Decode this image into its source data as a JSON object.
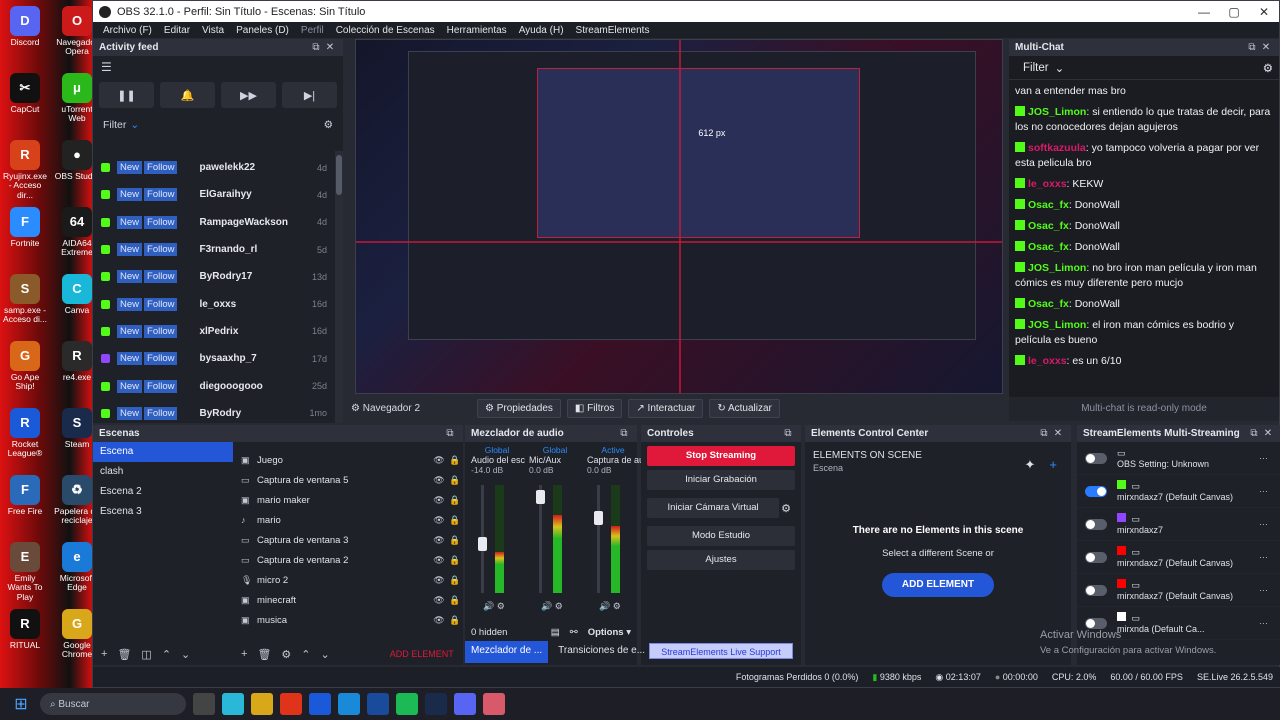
{
  "window": {
    "title": "OBS 32.1.0 - Perfil: Sin Título - Escenas: Sin Título"
  },
  "menu": [
    "Archivo (F)",
    "Editar",
    "Vista",
    "Paneles (D)",
    "Perfil",
    "Colección de Escenas",
    "Herramientas",
    "Ayuda (H)",
    "StreamElements"
  ],
  "desktop_icons": [
    {
      "label": "Discord",
      "color": "#5865f2",
      "glyph": "D"
    },
    {
      "label": "CapCut",
      "color": "#111111",
      "glyph": "✂"
    },
    {
      "label": "Ryujinx.exe - Acceso dir...",
      "color": "#d8421a",
      "glyph": "R"
    },
    {
      "label": "Fortnite",
      "color": "#2a8cff",
      "glyph": "F"
    },
    {
      "label": "samp.exe - Acceso di...",
      "color": "#8a5a2a",
      "glyph": "S"
    },
    {
      "label": "Go Ape Ship!",
      "color": "#d8671a",
      "glyph": "G"
    },
    {
      "label": "Rocket League®",
      "color": "#1a5ad8",
      "glyph": "R"
    },
    {
      "label": "Free Fire",
      "color": "#2a6ab8",
      "glyph": "F"
    },
    {
      "label": "Emily Wants To Play",
      "color": "#6a4a3a",
      "glyph": "E"
    },
    {
      "label": "RITUAL",
      "color": "#111111",
      "glyph": "R"
    }
  ],
  "desktop_icons2": [
    {
      "label": "Navegador Opera",
      "color": "#cc1a1a",
      "glyph": "O"
    },
    {
      "label": "uTorrent Web",
      "color": "#2ab81a",
      "glyph": "μ"
    },
    {
      "label": "OBS Studio",
      "color": "#222222",
      "glyph": "●"
    },
    {
      "label": "AIDA64 Extreme",
      "color": "#1a1a1a",
      "glyph": "64"
    },
    {
      "label": "Canva",
      "color": "#1ab8d8",
      "glyph": "C"
    },
    {
      "label": "re4.exe",
      "color": "#2a2a2a",
      "glyph": "R"
    },
    {
      "label": "Steam",
      "color": "#1a2a4a",
      "glyph": "S"
    },
    {
      "label": "Papelera de reciclaje",
      "color": "#2a4a6a",
      "glyph": "♻"
    },
    {
      "label": "Microsoft Edge",
      "color": "#1a7ad8",
      "glyph": "e"
    },
    {
      "label": "Google Chrome",
      "color": "#d8a81a",
      "glyph": "G"
    }
  ],
  "activity": {
    "title": "Activity feed",
    "filter": "Filter",
    "new_label": "New",
    "follow_label": "Follow",
    "items": [
      {
        "name": "pawelekk22",
        "ago": "4d",
        "platform": "kick"
      },
      {
        "name": "ElGaraihyy",
        "ago": "4d",
        "platform": "kick"
      },
      {
        "name": "RampageWackson",
        "ago": "4d",
        "platform": "kick"
      },
      {
        "name": "F3rnando_rl",
        "ago": "5d",
        "platform": "kick"
      },
      {
        "name": "ByRodry17",
        "ago": "13d",
        "platform": "kick"
      },
      {
        "name": "le_oxxs",
        "ago": "16d",
        "platform": "kick"
      },
      {
        "name": "xlPedrix",
        "ago": "16d",
        "platform": "kick"
      },
      {
        "name": "bysaaxhp_7",
        "ago": "17d",
        "platform": "twitch"
      },
      {
        "name": "diegooogooo",
        "ago": "25d",
        "platform": "kick"
      },
      {
        "name": "ByRodry",
        "ago": "1mo",
        "platform": "kick"
      }
    ]
  },
  "preview": {
    "zoom_label": "612 px"
  },
  "source_toolbar": {
    "nav": "Navegador 2",
    "props": "Propiedades",
    "filters": "Filtros",
    "interact": "Interactuar",
    "refresh": "Actualizar"
  },
  "multichat": {
    "title": "Multi-Chat",
    "filter": "Filter",
    "footer": "Multi-chat is read-only mode",
    "messages": [
      {
        "user": "",
        "text": "van a entender mas bro",
        "color": "#ffffff"
      },
      {
        "user": "JOS_Limon",
        "text": "si entiendo lo que tratas de decir, para los no conocedores dejan agujeros",
        "color": "#53fc18"
      },
      {
        "user": "softkazuula",
        "text": "yo tampoco volveria a pagar por ver esta pelicula bro",
        "color": "#d81a6a"
      },
      {
        "user": "le_oxxs",
        "text": "KEKW",
        "color": "#d81a6a"
      },
      {
        "user": "Osac_fx",
        "text": "DonoWall",
        "color": "#53fc18"
      },
      {
        "user": "Osac_fx",
        "text": "DonoWall",
        "color": "#53fc18"
      },
      {
        "user": "Osac_fx",
        "text": "DonoWall",
        "color": "#53fc18"
      },
      {
        "user": "JOS_Limon",
        "text": "no bro iron man película y iron man cómics es muy diferente pero mucjo",
        "color": "#53fc18"
      },
      {
        "user": "Osac_fx",
        "text": "DonoWall",
        "color": "#53fc18"
      },
      {
        "user": "JOS_Limon",
        "text": "el iron man cómics es bodrio y película es bueno",
        "color": "#53fc18"
      },
      {
        "user": "le_oxxs",
        "text": "es un 6/10",
        "color": "#d81a6a"
      }
    ]
  },
  "scenes": {
    "title": "Escenas",
    "items": [
      "Escena",
      "clash",
      "Escena 2",
      "Escena 3"
    ],
    "selected": 0
  },
  "sources": {
    "items": [
      {
        "name": "Juego",
        "icon": "▣"
      },
      {
        "name": "Captura de ventana 5",
        "icon": "▭"
      },
      {
        "name": "mario maker",
        "icon": "▣"
      },
      {
        "name": "mario",
        "icon": "♪"
      },
      {
        "name": "Captura de ventana 3",
        "icon": "▭"
      },
      {
        "name": "Captura de ventana 2",
        "icon": "▭"
      },
      {
        "name": "micro 2",
        "icon": "🎙"
      },
      {
        "name": "minecraft",
        "icon": "▣"
      },
      {
        "name": "musica",
        "icon": "▣"
      }
    ],
    "add_element": "ADD ELEMENT"
  },
  "mixer": {
    "title": "Mezclador de audio",
    "channels": [
      {
        "group": "Global",
        "name": "Audio del escritorio",
        "db": "-14.0 dB",
        "level": 0.38,
        "fader": 0.55
      },
      {
        "group": "Global",
        "name": "Mic/Aux",
        "db": "0.0 dB",
        "level": 0.72,
        "fader": 0.05
      },
      {
        "group": "Active",
        "name": "Captura de audio",
        "db": "0.0 dB",
        "level": 0.62,
        "fader": 0.28
      }
    ],
    "hidden": "0 hidden",
    "options": "Options",
    "tab_active": "Mezclador de ...",
    "tab_other": "Transiciones de e..."
  },
  "controls": {
    "title": "Controles",
    "stop": "Stop Streaming",
    "record": "Iniciar Grabación",
    "virtual_cam": "Iniciar Cámara Virtual",
    "studio": "Modo Estudio",
    "settings": "Ajustes",
    "live_support": "StreamElements Live Support"
  },
  "ecc": {
    "title": "Elements Control Center",
    "heading": "ELEMENTS ON SCENE",
    "scene": "Escena",
    "empty": "There are no Elements in this scene",
    "hint": "Select a different Scene or",
    "button": "ADD ELEMENT"
  },
  "sems": {
    "title": "StreamElements Multi-Streaming",
    "rows": [
      {
        "label": "OBS Setting: Unknown",
        "on": false,
        "platform": ""
      },
      {
        "label": "mirxndaxz7 (Default Canvas)",
        "on": true,
        "platform": "kick"
      },
      {
        "label": "mirxndaxz7",
        "on": false,
        "platform": "twitch"
      },
      {
        "label": "mirxndaxz7 (Default Canvas)",
        "on": false,
        "platform": "youtube"
      },
      {
        "label": "mirxndaxz7 (Default Canvas)",
        "on": false,
        "platform": "youtube"
      },
      {
        "label": "mirxnda (Default Ca...",
        "on": false,
        "platform": "tiktok"
      }
    ]
  },
  "status": {
    "dropped": "Fotogramas Perdidos 0 (0.0%)",
    "bitrate": "9380 kbps",
    "live_time": "02:13:07",
    "rec_time": "00:00:00",
    "cpu": "CPU: 2.0%",
    "fps": "60.00 / 60.00 FPS",
    "version": "SE.Live 26.2.5.549"
  },
  "watermark": {
    "line1": "Activar Windows",
    "line2": "Ve a Configuración para activar Windows."
  },
  "taskbar": {
    "search": "Buscar"
  },
  "colors": {
    "kick": "#53fc18",
    "twitch": "#9146ff",
    "youtube": "#ff0000",
    "tiktok": "#ffffff",
    "accent": "#2457d8"
  }
}
